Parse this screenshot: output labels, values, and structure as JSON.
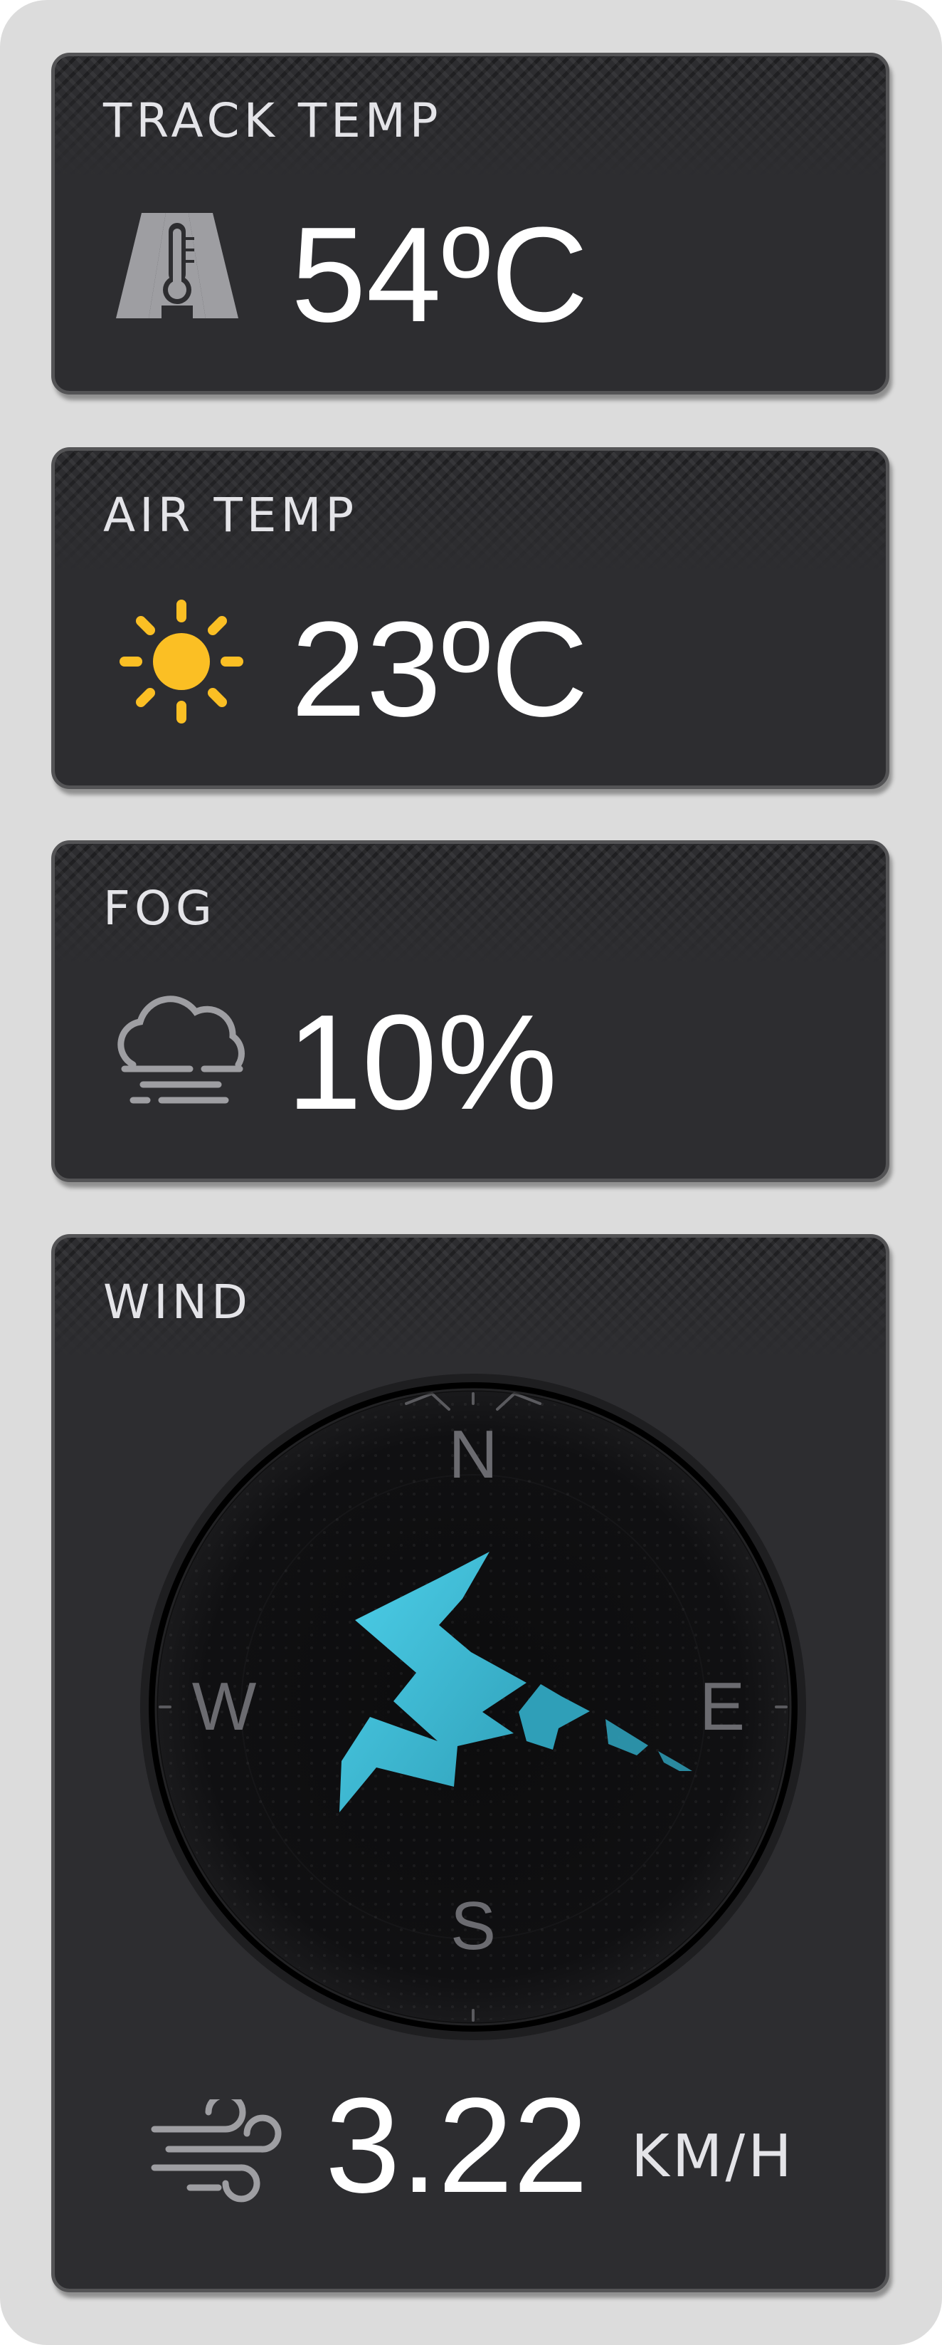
{
  "track_temp": {
    "title": "TRACK TEMP",
    "value": "54ºC",
    "icon": "track-thermometer-icon"
  },
  "air_temp": {
    "title": "AIR TEMP",
    "value": "23ºC",
    "icon": "sun-icon",
    "icon_color": "#fbbf24"
  },
  "fog": {
    "title": "FOG",
    "value": "10%",
    "icon": "fog-cloud-icon"
  },
  "wind": {
    "title": "WIND",
    "compass": {
      "north": "N",
      "east": "E",
      "south": "S",
      "west": "W"
    },
    "arrow_color": "#45c8e4",
    "speed": "3.22",
    "unit": "KM/H",
    "icon": "wind-icon"
  }
}
